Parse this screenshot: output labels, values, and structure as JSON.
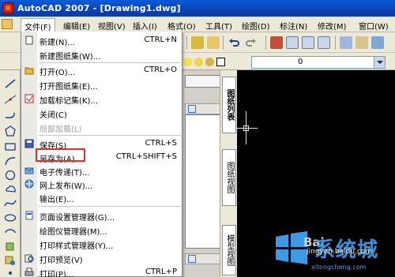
{
  "window": {
    "title": "AutoCAD 2007 - [Drawing1.dwg]"
  },
  "menubar": {
    "items": [
      {
        "label": "文件(F)",
        "active": true
      },
      {
        "label": "编辑(E)"
      },
      {
        "label": "视图(V)"
      },
      {
        "label": "插入(I)"
      },
      {
        "label": "格式(O)"
      },
      {
        "label": "工具(T)"
      },
      {
        "label": "绘图(D)"
      },
      {
        "label": "标注(N)"
      },
      {
        "label": "修改(M)"
      },
      {
        "label": "窗口(W)"
      }
    ]
  },
  "layer_toolbar": {
    "current_layer": "0"
  },
  "file_menu": {
    "items": [
      {
        "label": "新建(N)...",
        "shortcut": "CTRL+N",
        "icon": "new-file-icon"
      },
      {
        "label": "新建图纸集(W)...",
        "shortcut": "",
        "icon": ""
      },
      {
        "label": "打开(O)...",
        "shortcut": "CTRL+O",
        "icon": "open-folder-icon"
      },
      {
        "label": "打开图纸集(E)...",
        "shortcut": "",
        "icon": ""
      },
      {
        "label": "加载标记集(K)...",
        "shortcut": "",
        "icon": "markup-icon"
      },
      {
        "label": "关闭(C)",
        "shortcut": "",
        "icon": ""
      },
      {
        "label": "局部加载(L)",
        "shortcut": "",
        "icon": "",
        "disabled": true
      },
      {
        "label": "保存(S)",
        "shortcut": "CTRL+S",
        "icon": "save-disk-icon"
      },
      {
        "label": "另存为(A)...",
        "shortcut": "CTRL+SHIFT+S",
        "icon": "",
        "highlighted": true
      },
      {
        "label": "电子传递(T)...",
        "shortcut": "",
        "icon": "etransmit-icon"
      },
      {
        "label": "网上发布(W)...",
        "shortcut": "",
        "icon": "publish-web-icon"
      },
      {
        "label": "输出(E)...",
        "shortcut": "",
        "icon": ""
      },
      {
        "label": "页面设置管理器(G)...",
        "shortcut": "",
        "icon": "page-setup-icon"
      },
      {
        "label": "绘图仪管理器(M)...",
        "shortcut": "",
        "icon": ""
      },
      {
        "label": "打印样式管理器(Y)...",
        "shortcut": "",
        "icon": ""
      },
      {
        "label": "打印预览(V)",
        "shortcut": "",
        "icon": "print-preview-icon"
      },
      {
        "label": "打印(P)...",
        "shortcut": "CTRL+P",
        "icon": "print-icon"
      }
    ]
  },
  "side_tabs": [
    {
      "label": "图纸列表"
    },
    {
      "label": "图纸视图"
    },
    {
      "label": "模型视图"
    }
  ],
  "watermark": {
    "brand": "系统城",
    "site": "xitongcheng.com",
    "jingyan": "jingyan.baidu.com",
    "baidu": "Bai"
  },
  "colors": {
    "titlebar": "#0a44b4",
    "highlight": "#e03030",
    "canvas": "#000000"
  }
}
